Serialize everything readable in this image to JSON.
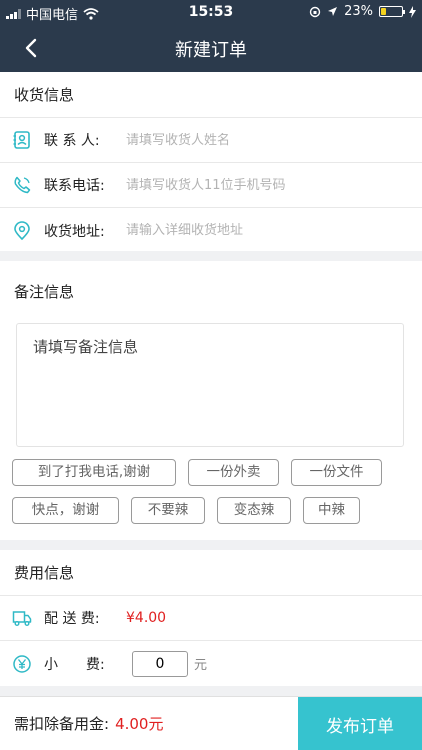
{
  "status_bar": {
    "carrier": "中国电信",
    "time": "15:53",
    "battery": "23%",
    "battery_level": 0.23
  },
  "nav": {
    "title": "新建订单"
  },
  "receiver": {
    "title": "收货信息",
    "contact_label": "联 系 人:",
    "contact_placeholder": "请填写收货人姓名",
    "phone_label": "联系电话:",
    "phone_placeholder": "请填写收货人11位手机号码",
    "address_label": "收货地址:",
    "address_placeholder": "请输入详细收货地址"
  },
  "note": {
    "title": "备注信息",
    "placeholder": "请填写备注信息",
    "tags": [
      "到了打我电话,谢谢",
      "一份外卖",
      "一份文件",
      "快点，谢谢",
      "不要辣",
      "变态辣",
      "中辣"
    ]
  },
  "fees": {
    "title": "费用信息",
    "delivery_label": "配 送 费:",
    "delivery_amount": "¥4.00",
    "tip_label": "小　　费:",
    "tip_value": "0",
    "tip_unit": "元"
  },
  "footer": {
    "sum_label": "需扣除备用金:",
    "sum_amount": "4.00元",
    "publish_label": "发布订单"
  },
  "colors": {
    "header_bg": "#2b3a4c",
    "accent": "#36c3cf",
    "price": "#e02020",
    "icon": "#2fb9c6"
  }
}
